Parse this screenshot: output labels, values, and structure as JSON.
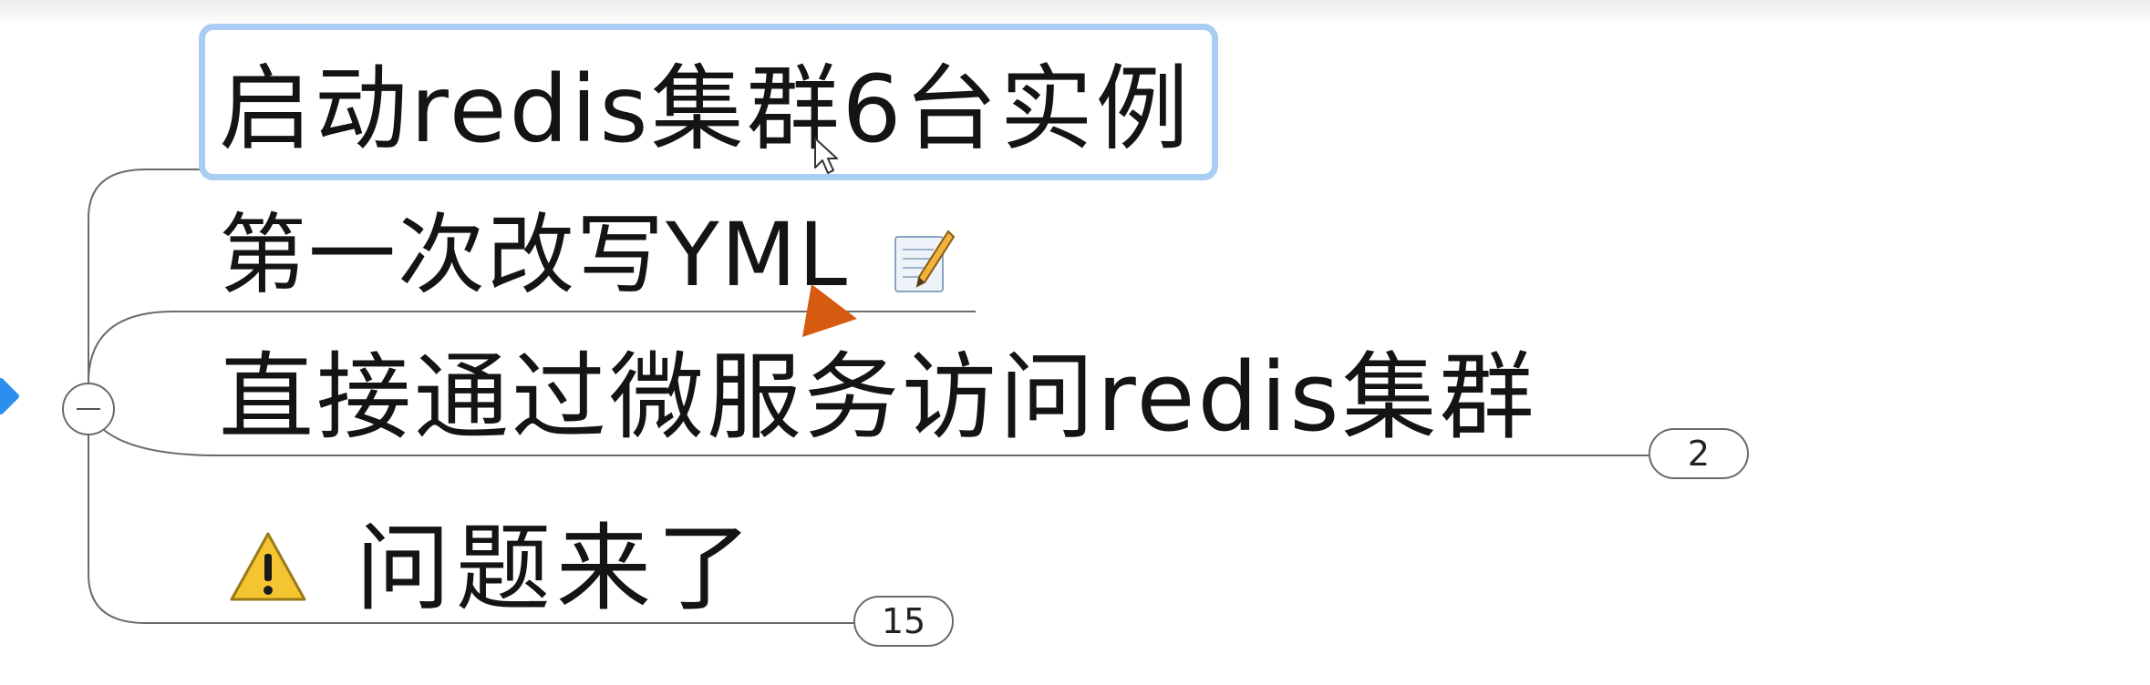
{
  "mindmap": {
    "topics": [
      {
        "label": "启动redis集群6台实例",
        "selected": true
      },
      {
        "label": "第一次改写YML",
        "icon": "note-icon"
      },
      {
        "label": "直接通过微服务访问redis集群",
        "collapsed_count": "2"
      },
      {
        "label": "问题来了",
        "icon": "warning-icon",
        "collapsed_count": "15"
      }
    ],
    "collapse_symbol": "−"
  },
  "colors": {
    "selection_border": "#a9cdf3",
    "connector": "#6a6a6a",
    "handle": "#2b8ff0",
    "drag_arrow": "#d65a0f",
    "warning_fill": "#f5c431"
  }
}
